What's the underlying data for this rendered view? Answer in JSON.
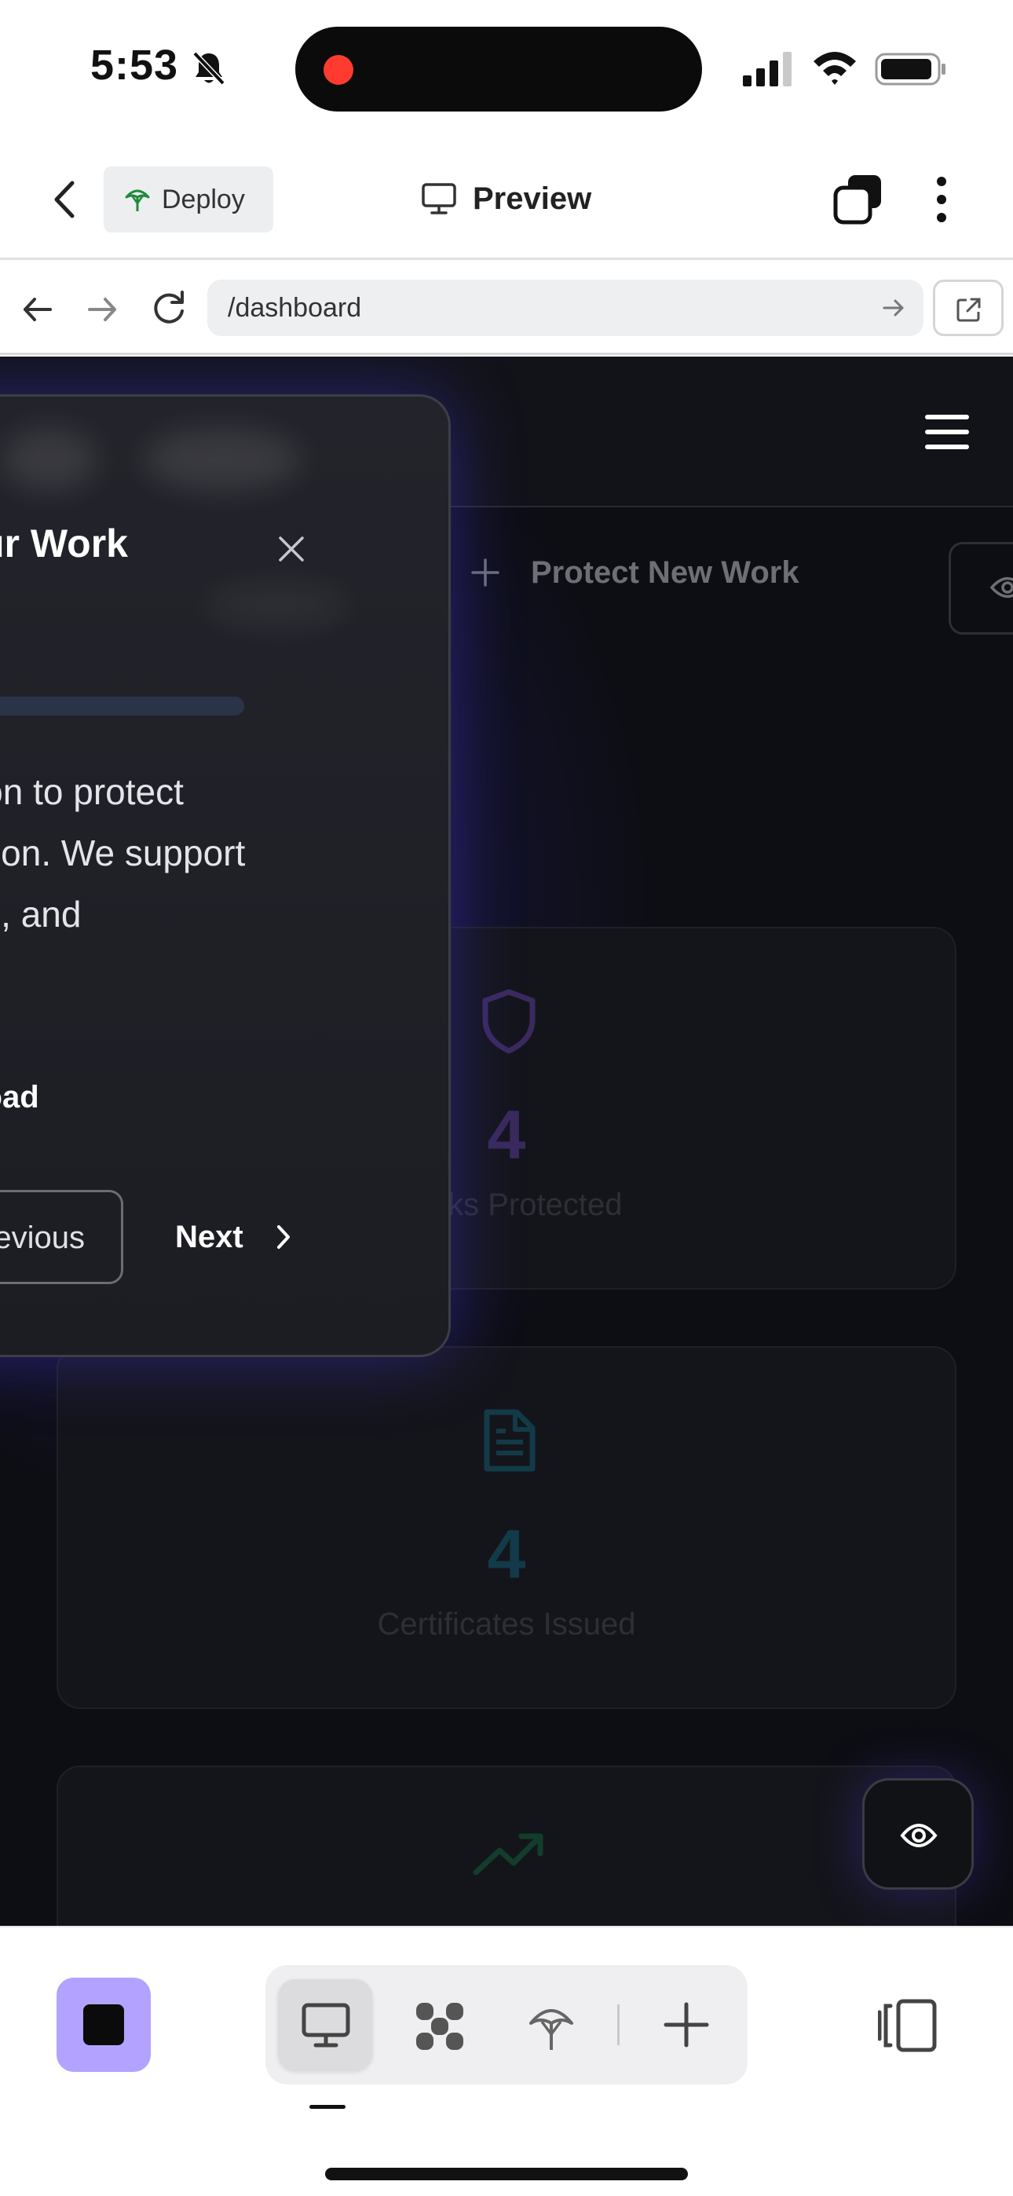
{
  "status_bar": {
    "time": "5:53"
  },
  "app_header": {
    "deploy_label": "Deploy",
    "title": "Preview"
  },
  "browser": {
    "url": "/dashboard"
  },
  "site": {
    "primary_action": "Protect New Work",
    "stats": [
      {
        "value": "4",
        "label": "Works Protected",
        "color": "#3a2a5c",
        "icon": "shield-icon"
      },
      {
        "value": "4",
        "label": "Certificates Issued",
        "color": "#123a48",
        "icon": "file-text-icon"
      },
      {
        "icon": "trending-up-icon"
      }
    ]
  },
  "tour": {
    "title": "ur Work",
    "body": "utton to protect\neation. We support\neos, and",
    "step_hint": "pload",
    "prev_label": "Previous",
    "next_label": "Next"
  },
  "colors": {
    "accent": "#b3a2ff",
    "recording": "#ff3b30",
    "background": "#0d0e14"
  }
}
